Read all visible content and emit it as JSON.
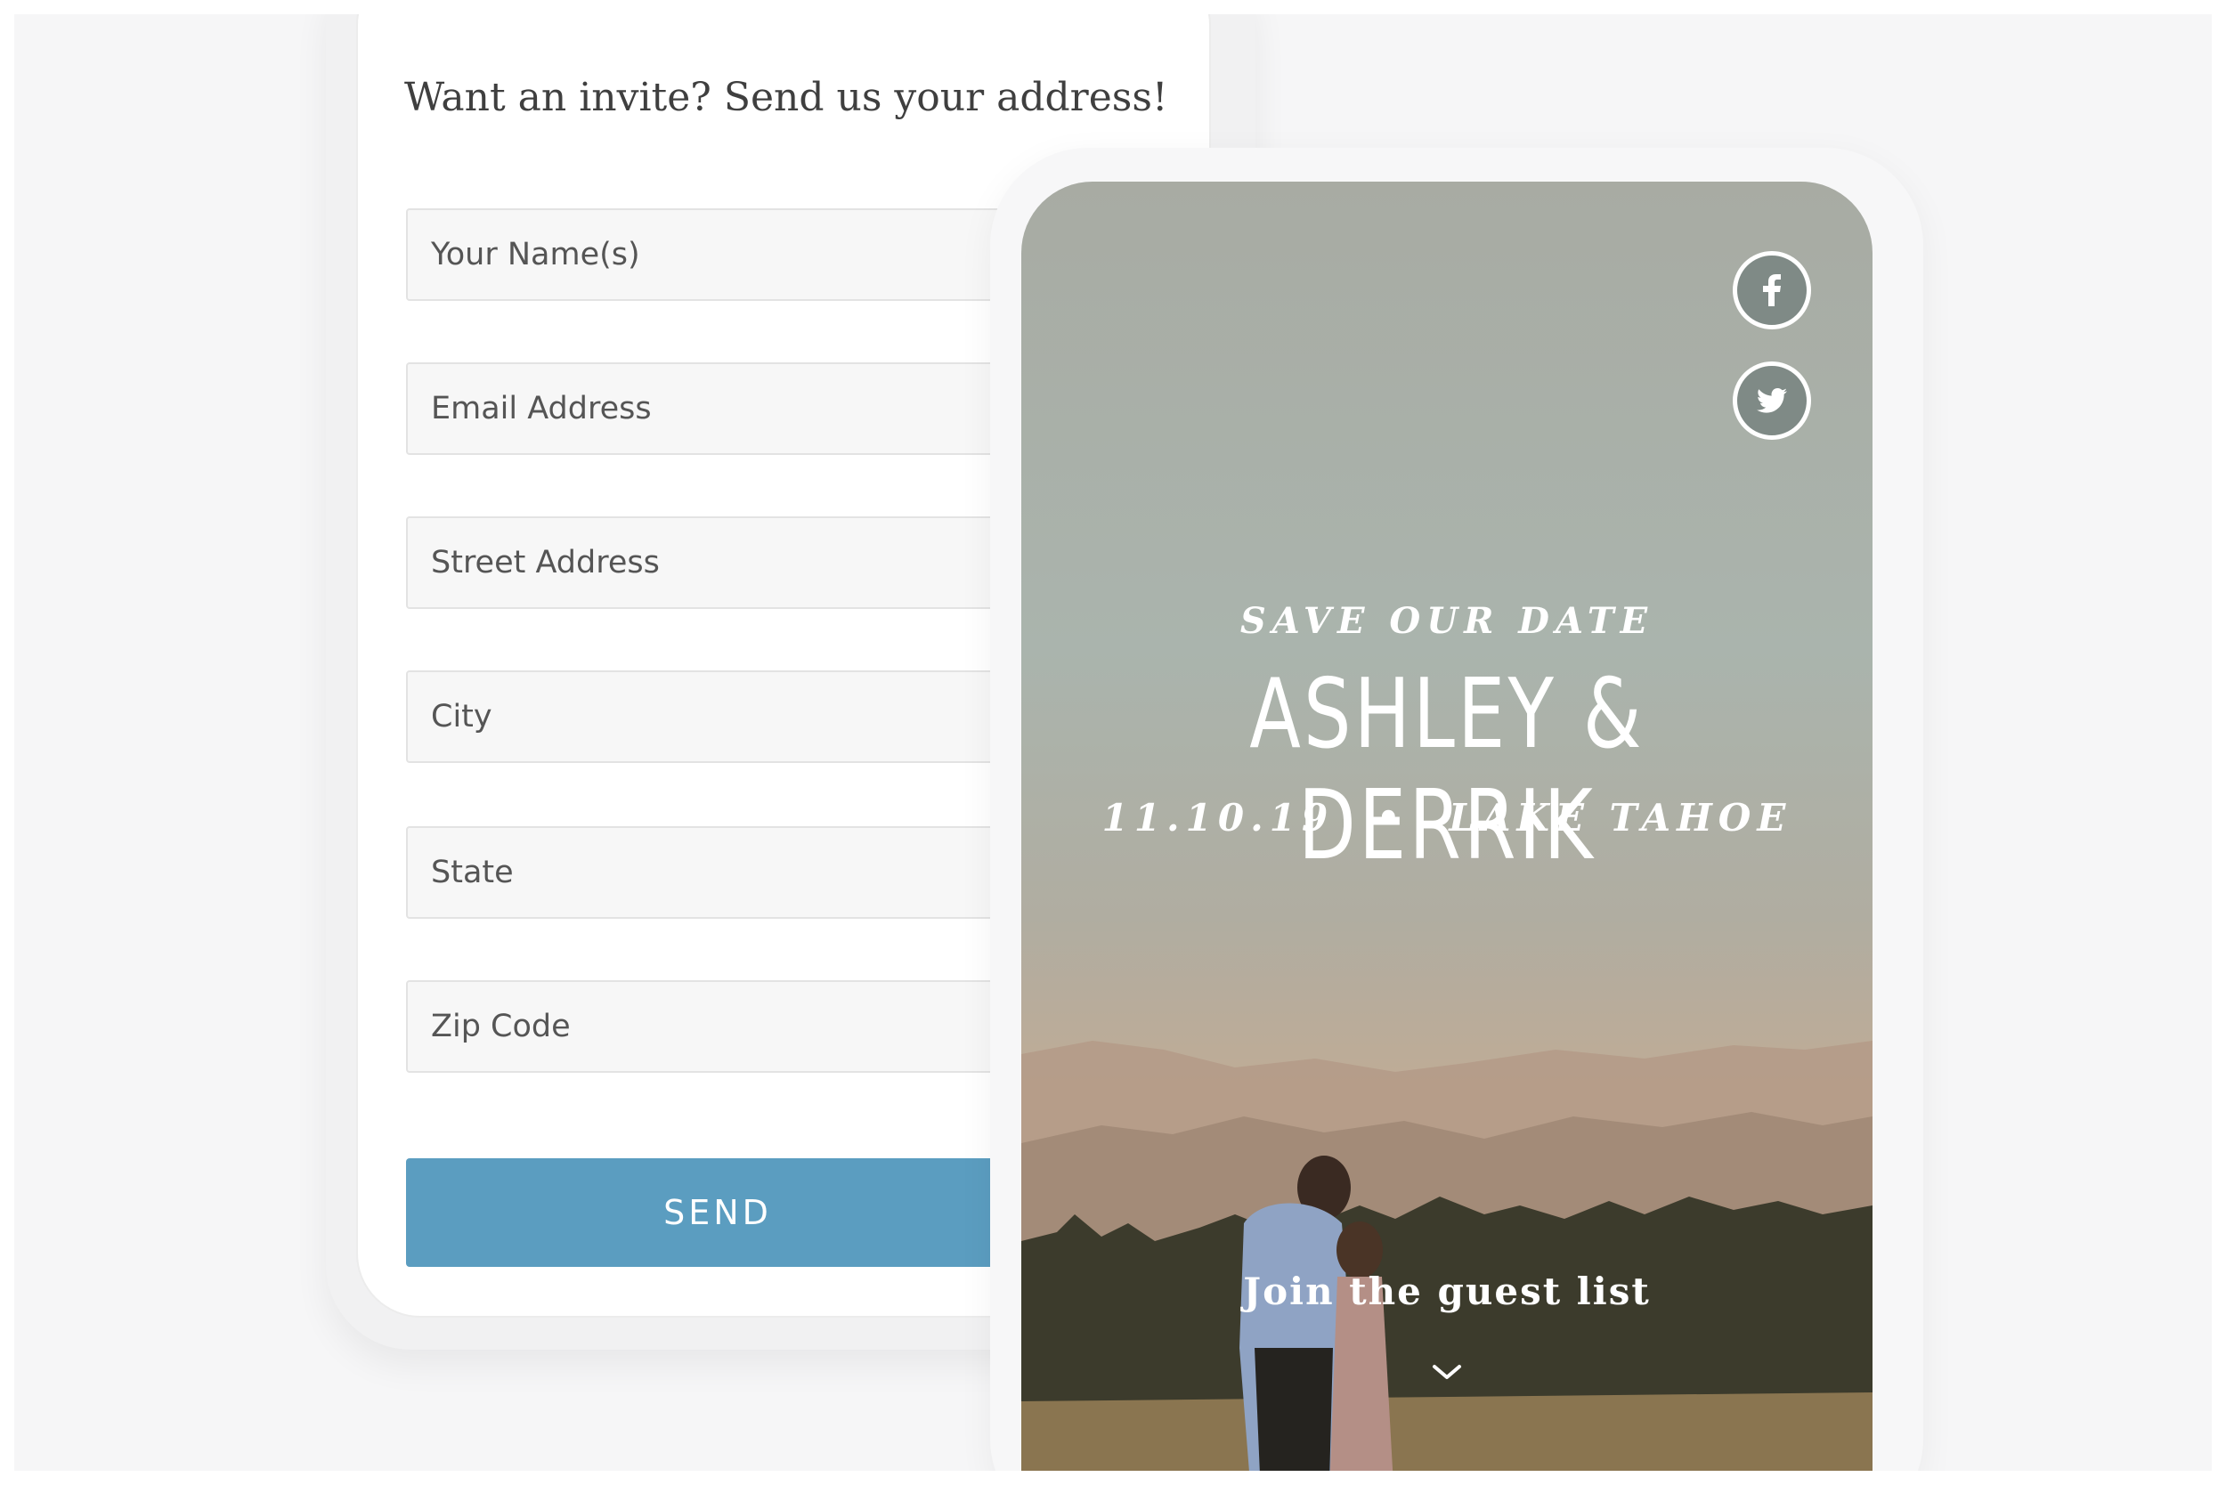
{
  "form": {
    "title": "Want an invite? Send us your address!",
    "fields": [
      {
        "placeholder": "Your Name(s)"
      },
      {
        "placeholder": "Email Address"
      },
      {
        "placeholder": "Street Address"
      },
      {
        "placeholder": "City"
      },
      {
        "placeholder": "State"
      },
      {
        "placeholder": "Zip Code"
      }
    ],
    "send_label": "SEND"
  },
  "invite": {
    "eyebrow": "SAVE OUR DATE",
    "names": "ASHLEY & DERRIK",
    "date": "11.10.19",
    "separator": "•",
    "location": "LAKE TAHOE",
    "cta": "Join the guest list",
    "social": [
      {
        "icon": "facebook-icon"
      },
      {
        "icon": "twitter-icon"
      }
    ]
  },
  "colors": {
    "accent": "#5b9dc0",
    "social_bg": "#7f8a86"
  }
}
